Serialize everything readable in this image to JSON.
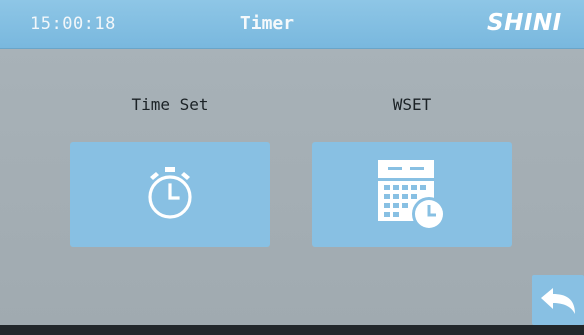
{
  "header": {
    "clock": "15:00:18",
    "title": "Timer",
    "logo": "SHINI"
  },
  "menu": {
    "items": [
      {
        "label": "Time Set",
        "icon": "stopwatch-icon"
      },
      {
        "label": "WSET",
        "icon": "calendar-clock-icon"
      }
    ]
  },
  "footer": {
    "back_icon": "back-arrow-icon"
  },
  "colors": {
    "header_blue": "#7fbde2",
    "tile_blue": "#88c0e3",
    "background_grey": "#a6b0b6",
    "icon_white": "#ffffff"
  }
}
